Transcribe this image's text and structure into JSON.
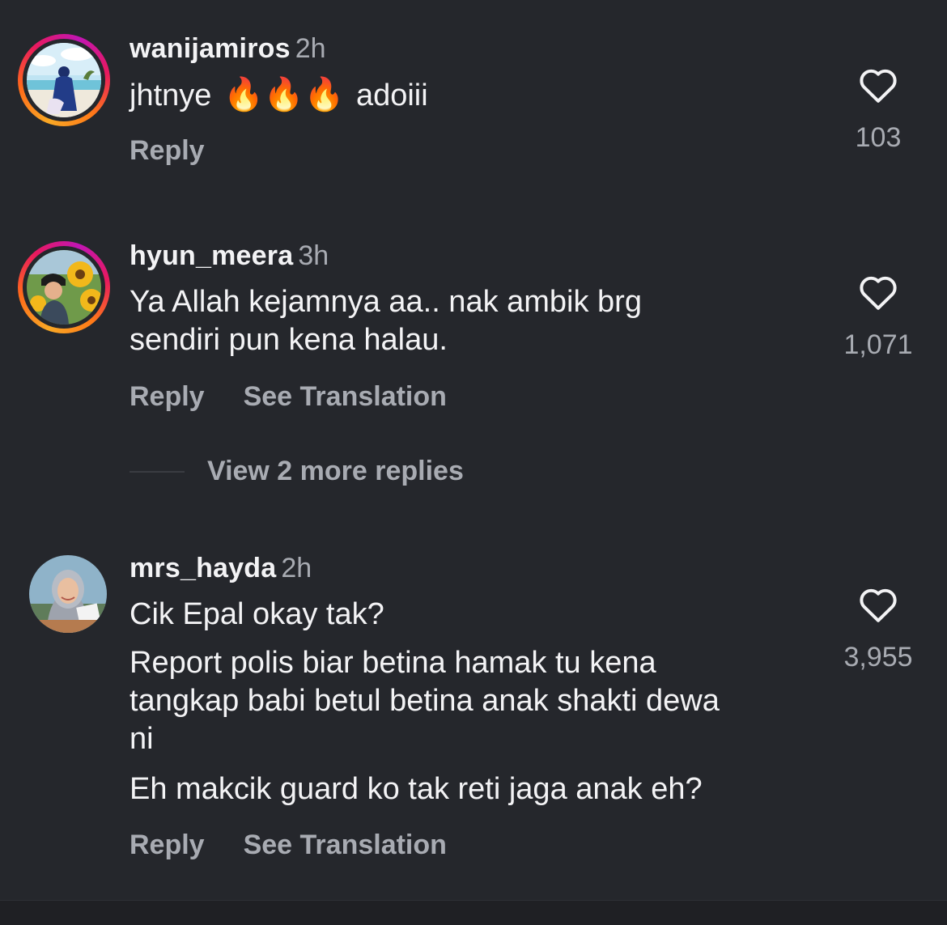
{
  "comments": [
    {
      "username": "wanijamiros",
      "time": "2h",
      "text_before": "jhtnye",
      "emoji": "🔥🔥🔥",
      "text_after": "adoiii",
      "reply_label": "Reply",
      "like_count": "103",
      "like_icon": "heart-outline-icon",
      "avatar_ring": true
    },
    {
      "username": "hyun_meera",
      "time": "3h",
      "lines": [
        "Ya Allah kejamnya aa.. nak ambik brg",
        "sendiri pun kena halau."
      ],
      "reply_label": "Reply",
      "translation_label": "See Translation",
      "like_count": "1,071",
      "like_icon": "heart-outline-icon",
      "avatar_ring": true,
      "view_replies_label": "View 2 more replies"
    },
    {
      "username": "mrs_hayda",
      "time": "2h",
      "lines": [
        "Cik Epal okay tak?",
        "Report polis biar betina hamak tu kena",
        "tangkap babi betul betina anak shakti dewa",
        "ni",
        "Eh makcik guard ko tak reti jaga anak eh?"
      ],
      "reply_label": "Reply",
      "translation_label": "See Translation",
      "like_count": "3,955",
      "like_icon": "heart-outline-icon",
      "avatar_ring": false
    }
  ],
  "colors": {
    "background": "#25272c",
    "text_primary": "#f3f3f5",
    "text_secondary": "#a8abb2",
    "story_ring": [
      "#f9a825",
      "#ff6a1a",
      "#e8195f",
      "#c116b4"
    ]
  }
}
